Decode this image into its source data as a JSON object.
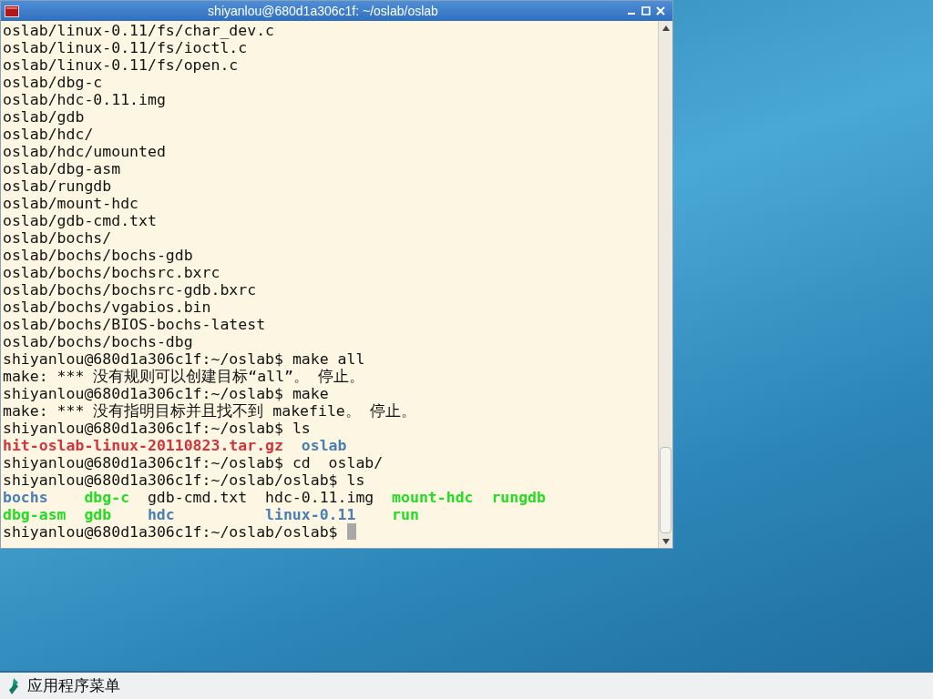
{
  "window": {
    "title": "shiyanlou@680d1a306c1f: ~/oslab/oslab"
  },
  "terminal": {
    "cursor_visible": true,
    "lines": [
      {
        "kind": "text",
        "text": "oslab/linux-0.11/fs/char_dev.c"
      },
      {
        "kind": "text",
        "text": "oslab/linux-0.11/fs/ioctl.c"
      },
      {
        "kind": "text",
        "text": "oslab/linux-0.11/fs/open.c"
      },
      {
        "kind": "text",
        "text": "oslab/dbg-c"
      },
      {
        "kind": "text",
        "text": "oslab/hdc-0.11.img"
      },
      {
        "kind": "text",
        "text": "oslab/gdb"
      },
      {
        "kind": "text",
        "text": "oslab/hdc/"
      },
      {
        "kind": "text",
        "text": "oslab/hdc/umounted"
      },
      {
        "kind": "text",
        "text": "oslab/dbg-asm"
      },
      {
        "kind": "text",
        "text": "oslab/rungdb"
      },
      {
        "kind": "text",
        "text": "oslab/mount-hdc"
      },
      {
        "kind": "text",
        "text": "oslab/gdb-cmd.txt"
      },
      {
        "kind": "text",
        "text": "oslab/bochs/"
      },
      {
        "kind": "text",
        "text": "oslab/bochs/bochs-gdb"
      },
      {
        "kind": "text",
        "text": "oslab/bochs/bochsrc.bxrc"
      },
      {
        "kind": "text",
        "text": "oslab/bochs/bochsrc-gdb.bxrc"
      },
      {
        "kind": "text",
        "text": "oslab/bochs/vgabios.bin"
      },
      {
        "kind": "text",
        "text": "oslab/bochs/BIOS-bochs-latest"
      },
      {
        "kind": "text",
        "text": "oslab/bochs/bochs-dbg"
      },
      {
        "kind": "text",
        "text": "shiyanlou@680d1a306c1f:~/oslab$ make all"
      },
      {
        "kind": "text",
        "text": "make: *** 没有规则可以创建目标“all”。 停止。"
      },
      {
        "kind": "text",
        "text": "shiyanlou@680d1a306c1f:~/oslab$ make"
      },
      {
        "kind": "text",
        "text": "make: *** 没有指明目标并且找不到 makefile。 停止。"
      },
      {
        "kind": "text",
        "text": "shiyanlou@680d1a306c1f:~/oslab$ ls"
      },
      {
        "kind": "listing",
        "rows": [
          [
            {
              "text": "hit-oslab-linux-20110823.tar.gz",
              "color": "#d0343c"
            },
            {
              "text": "oslab",
              "color": "#4a7fb5"
            }
          ]
        ]
      },
      {
        "kind": "text",
        "text": "shiyanlou@680d1a306c1f:~/oslab$ cd  oslab/"
      },
      {
        "kind": "text",
        "text": "shiyanlou@680d1a306c1f:~/oslab/oslab$ ls"
      },
      {
        "kind": "listing",
        "rows": [
          [
            {
              "text": "bochs",
              "color": "#4a7fb5"
            },
            {
              "text": "dbg-c",
              "color": "#22dd22"
            },
            {
              "text": "gdb-cmd.txt",
              "color": "#111111"
            },
            {
              "text": "hdc-0.11.img",
              "color": "#111111"
            },
            {
              "text": "mount-hdc",
              "color": "#22dd22"
            },
            {
              "text": "rungdb",
              "color": "#22dd22"
            }
          ],
          [
            {
              "text": "dbg-asm",
              "color": "#22dd22"
            },
            {
              "text": "gdb",
              "color": "#22dd22"
            },
            {
              "text": "hdc",
              "color": "#4a7fb5"
            },
            {
              "text": "linux-0.11",
              "color": "#4a7fb5"
            },
            {
              "text": "run",
              "color": "#22dd22"
            }
          ]
        ]
      },
      {
        "kind": "prompt",
        "text": "shiyanlou@680d1a306c1f:~/oslab/oslab$"
      }
    ]
  },
  "taskbar": {
    "menu_label": "应用程序菜单"
  }
}
